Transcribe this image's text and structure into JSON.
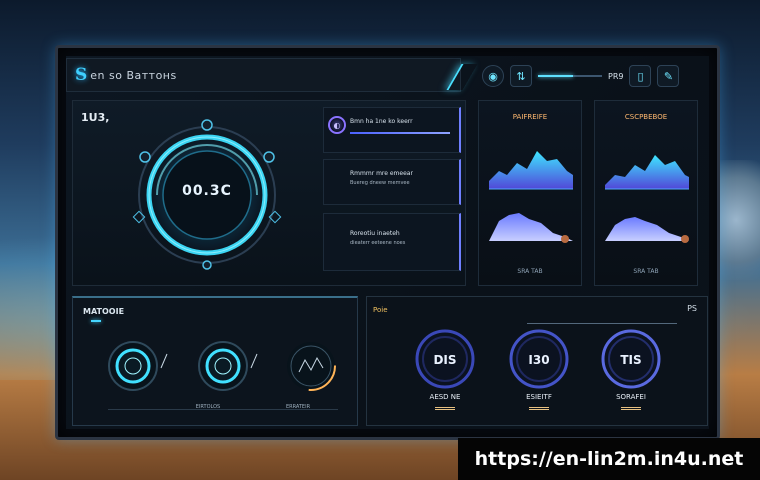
{
  "window": {
    "title": "en so Bаттонs",
    "logo_letter": "S"
  },
  "toolbar": {
    "value_label": "PR9"
  },
  "main_panel": {
    "label": "1U3,",
    "gauge_value": "00.3C",
    "info_cards": [
      {
        "title": "Bmn ha 1ne ko keerr"
      },
      {
        "title": "Rmmmr mre emeear",
        "sub": "Buereg dneew memvee"
      },
      {
        "title": "Roreotiu inaeteh",
        "sub": "dieaterr eeteene noes"
      }
    ]
  },
  "mini_charts": [
    {
      "title": "PAIFREIFE",
      "footer": "SRA TAB"
    },
    {
      "title": "CSCPBEBOE",
      "footer": "SRA TAB"
    }
  ],
  "bottom_left": {
    "title": "MATOOIE",
    "gauges": [
      {
        "label": "EIRTOLOS"
      },
      {
        "label": "ERRATEIR"
      },
      {
        "label": "BAIOIOCE"
      }
    ]
  },
  "bottom_right": {
    "title": "Poie",
    "right_label": "PS",
    "gauges": [
      {
        "value": "DIS",
        "label": "AESD NE"
      },
      {
        "value": "I30",
        "label": "ESIEITF"
      },
      {
        "value": "TIS",
        "label": "SORAFEI"
      }
    ]
  },
  "banner": {
    "url": "https://en-lin2m.in4u.net"
  },
  "colors": {
    "accent_cyan": "#46d6ff",
    "accent_violet": "#6f7fff",
    "accent_orange": "#ffb870"
  },
  "icons": [
    "aperture-icon",
    "transfer-icon",
    "slider-icon",
    "tablet-icon",
    "pen-icon",
    "lens-icon"
  ]
}
